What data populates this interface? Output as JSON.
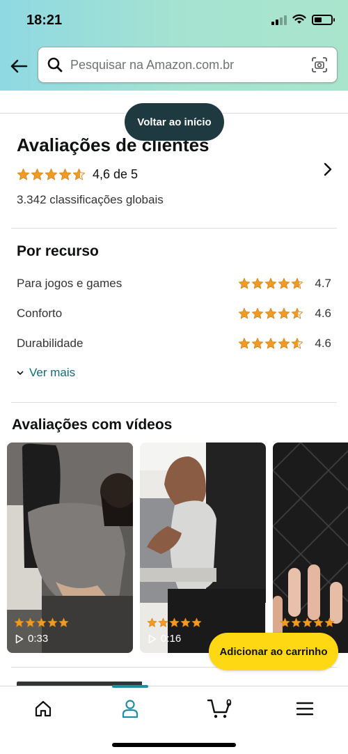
{
  "status_bar": {
    "time": "18:21"
  },
  "search": {
    "placeholder": "Pesquisar na Amazon.com.br"
  },
  "back_to_top": "Voltar ao início",
  "reviews": {
    "title": "Avaliações de clientes",
    "rating_value": 4.6,
    "rating_text": "4,6 de 5",
    "global_ratings": "3.342 classificações globais"
  },
  "by_feature": {
    "title": "Por recurso",
    "items": [
      {
        "label": "Para jogos e games",
        "rating": 4.7,
        "value": "4.7"
      },
      {
        "label": "Conforto",
        "rating": 4.6,
        "value": "4.6"
      },
      {
        "label": "Durabilidade",
        "rating": 4.6,
        "value": "4.6"
      }
    ],
    "see_more": "Ver mais"
  },
  "videos": {
    "title": "Avaliações com vídeos",
    "items": [
      {
        "duration": "0:33",
        "stars": 5
      },
      {
        "duration": "0:16",
        "stars": 5
      },
      {
        "duration": "",
        "stars": 5
      }
    ]
  },
  "add_to_cart": "Adicionar ao carrinho",
  "nav": {
    "items": [
      "home-icon",
      "account-icon",
      "cart-icon",
      "menu-icon"
    ],
    "cart_count": "0",
    "active": "account"
  },
  "colors": {
    "star": "#f29b24",
    "accent": "#1f8ea3",
    "cart_button": "#ffd814",
    "pill": "#1e3a40"
  }
}
